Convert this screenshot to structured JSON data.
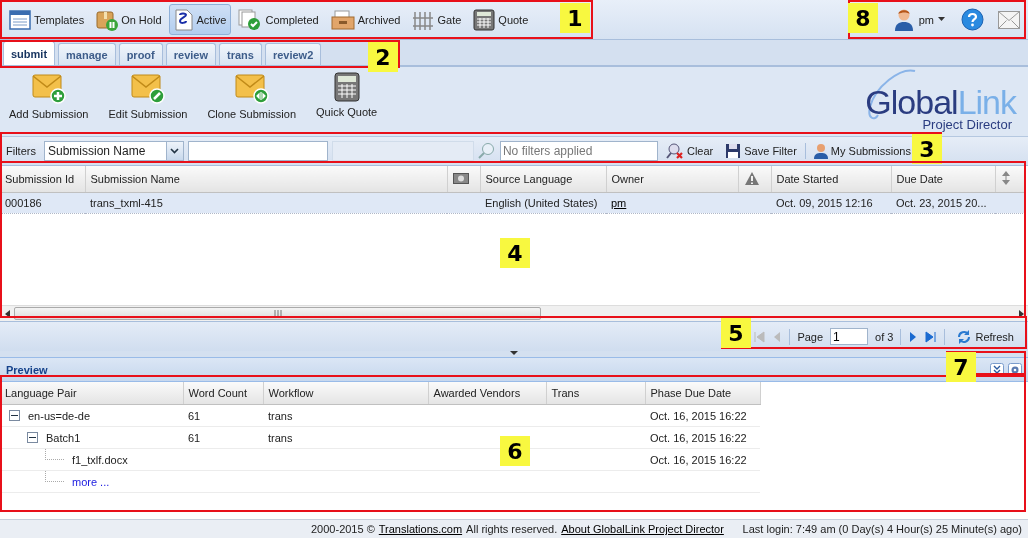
{
  "main_toolbar": [
    {
      "label": "Templates",
      "selected": false
    },
    {
      "label": "On Hold",
      "selected": false
    },
    {
      "label": "Active",
      "selected": true
    },
    {
      "label": "Completed",
      "selected": false
    },
    {
      "label": "Archived",
      "selected": false
    },
    {
      "label": "Gate",
      "selected": false
    },
    {
      "label": "Quote",
      "selected": false
    }
  ],
  "user_menu": {
    "user": "pm"
  },
  "tabs": [
    {
      "label": "submit",
      "selected": true
    },
    {
      "label": "manage",
      "selected": false
    },
    {
      "label": "proof",
      "selected": false
    },
    {
      "label": "review",
      "selected": false
    },
    {
      "label": "trans",
      "selected": false
    },
    {
      "label": "review2",
      "selected": false
    }
  ],
  "actions": [
    {
      "label": "Add Submission"
    },
    {
      "label": "Edit Submission"
    },
    {
      "label": "Clone Submission"
    },
    {
      "label": "Quick Quote"
    }
  ],
  "logo": {
    "name_dark": "Global",
    "name_light": "Link",
    "subtitle": "Project Director"
  },
  "filters": {
    "label": "Filters",
    "field": "Submission Name",
    "search_placeholder": "No filters applied",
    "clear": "Clear",
    "save": "Save Filter",
    "mine": "My Submissions"
  },
  "grid": {
    "columns": [
      {
        "label": "Submission Id",
        "kind": "text"
      },
      {
        "label": "Submission Name",
        "kind": "text"
      },
      {
        "kind": "money-icon"
      },
      {
        "label": "Source Language",
        "kind": "text"
      },
      {
        "label": "Owner",
        "kind": "text"
      },
      {
        "kind": "warning-icon"
      },
      {
        "label": "Date Started",
        "kind": "text"
      },
      {
        "label": "Due Date",
        "kind": "text"
      },
      {
        "kind": "sort-icon"
      }
    ],
    "rows": [
      {
        "selected": true,
        "cells": [
          "000186",
          "trans_txml-415",
          "",
          "English (United States)",
          "pm",
          "",
          "Oct. 09, 2015 12:16",
          "Oct. 23, 2015 20..."
        ]
      }
    ]
  },
  "paging": {
    "page_label": "Page",
    "page": "1",
    "of": "of 3",
    "refresh": "Refresh"
  },
  "preview": {
    "title": "Preview",
    "columns": [
      "Language Pair",
      "Word Count",
      "Workflow",
      "Awarded Vendors",
      "Trans",
      "Phase Due Date"
    ],
    "rows": [
      {
        "kind": "group",
        "expanded": true,
        "name": "en-us=de-de",
        "word_count": "61",
        "workflow": "trans",
        "due": "Oct. 16, 2015 16:22",
        "children": [
          {
            "kind": "group",
            "expanded": true,
            "name": "Batch1",
            "word_count": "61",
            "workflow": "trans",
            "due": "Oct. 16, 2015 16:22",
            "children": [
              {
                "kind": "file",
                "name": "f1_txlf.docx",
                "due": "Oct. 16, 2015 16:22"
              },
              {
                "kind": "more",
                "name": "more ..."
              }
            ]
          }
        ]
      }
    ]
  },
  "footer": {
    "copyright": "2000-2015 ©",
    "company_link": "Translations.com",
    "rights": "All rights reserved.",
    "about_link": "About GlobalLink Project Director",
    "last_login": "Last login: 7:49 am (0 Day(s) 4 Hour(s) 25 Minute(s) ago)"
  },
  "callouts": [
    {
      "label": "1"
    },
    {
      "label": "2"
    },
    {
      "label": "3"
    },
    {
      "label": "4"
    },
    {
      "label": "5"
    },
    {
      "label": "6"
    },
    {
      "label": "7"
    },
    {
      "label": "8"
    }
  ]
}
